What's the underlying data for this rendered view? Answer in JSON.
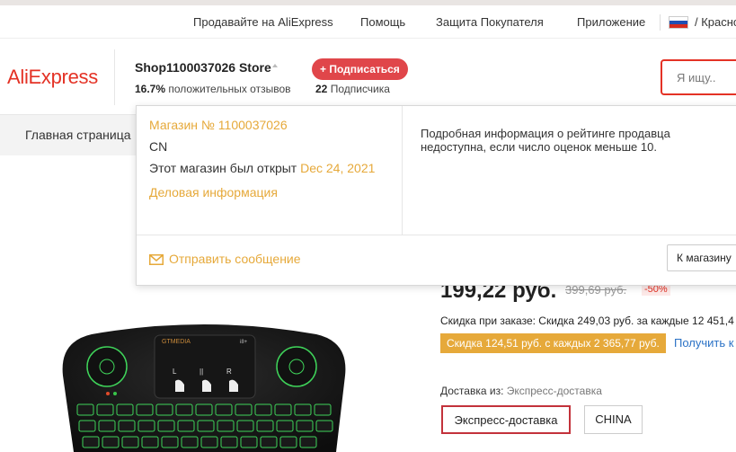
{
  "topbar": {
    "sell": "Продавайте на AliExpress",
    "help": "Помощь",
    "buyer_protection": "Защита Покупателя",
    "app": "Приложение",
    "region": "/ Красно"
  },
  "header": {
    "logo": "AliExpress",
    "store_name": "Shop1100037026 Store",
    "rating_value": "16.7%",
    "rating_label": "положительных отзывов",
    "subscribe_label": "+ Подписаться",
    "subscribers_count": "22",
    "subscribers_label": "Подписчика",
    "search_placeholder": "Я ищу.."
  },
  "nav": {
    "home": "Главная страница"
  },
  "store_popup": {
    "store_id": "Магазин № 1100037026",
    "country": "CN",
    "opened_label": "Этот магазин был открыт",
    "opened_date": "Dec 24, 2021",
    "business_info": "Деловая информация",
    "rating_notice": "Подробная информация о рейтинге продавца недоступна, если число оценок меньше 10.",
    "send_message": "Отправить сообщение",
    "to_store": "К магазину"
  },
  "product": {
    "price": "199,22 руб.",
    "old_price": "399,69 руб.",
    "discount": "-50%",
    "order_discount": "Скидка при заказе: Скидка 249,03 руб. за каждые 12 451,4",
    "coupon": "Скидка 124,51 руб. с каждых 2 365,77 руб.",
    "get_coupon": "Получить к",
    "delivery_label": "Доставка из:",
    "delivery_value": "Экспресс-доставка",
    "delivery_options": [
      "Экспресс-доставка",
      "CHINA"
    ],
    "brand_text": "GTMEDIA",
    "model_text": "i8+"
  },
  "colors": {
    "accent_red": "#e43225",
    "subscribe_red": "#e0464a",
    "gold": "#e6a93a",
    "link_blue": "#2b72c6"
  }
}
